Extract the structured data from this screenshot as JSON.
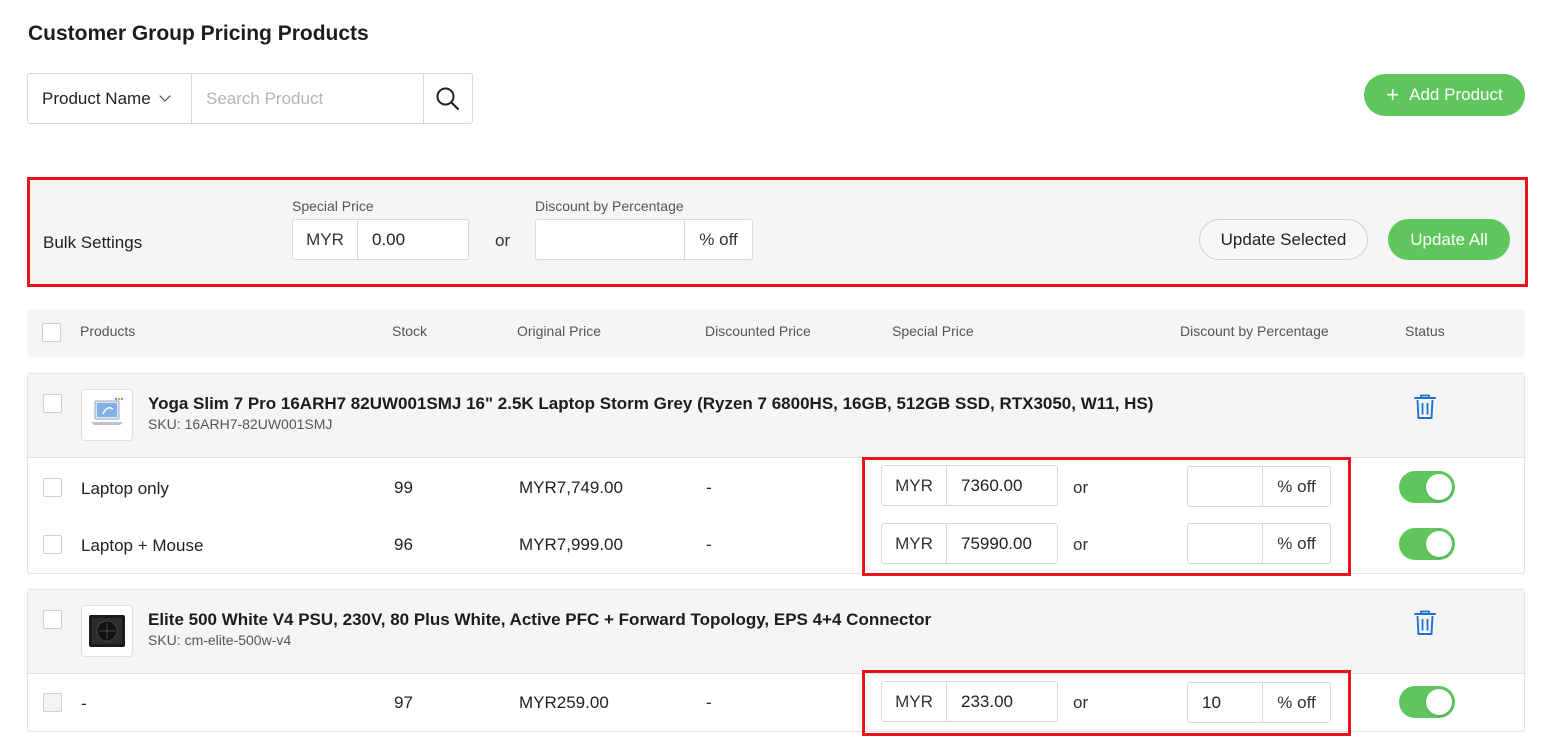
{
  "page_title": "Customer Group Pricing Products",
  "search": {
    "filter_label": "Product Name",
    "placeholder": "Search Product"
  },
  "add_product_label": "Add Product",
  "bulk": {
    "label": "Bulk Settings",
    "special_price_label": "Special Price",
    "currency": "MYR",
    "special_price_value": "0.00",
    "or": "or",
    "discount_label": "Discount by Percentage",
    "discount_value": "",
    "suffix": "% off",
    "update_selected": "Update Selected",
    "update_all": "Update All"
  },
  "table_headers": {
    "products": "Products",
    "stock": "Stock",
    "original_price": "Original Price",
    "discounted_price": "Discounted Price",
    "special_price": "Special Price",
    "discount_pct": "Discount by Percentage",
    "status": "Status"
  },
  "products": [
    {
      "name": "Yoga Slim 7 Pro 16ARH7 82UW001SMJ 16\" 2.5K Laptop Storm Grey (Ryzen 7 6800HS, 16GB, 512GB SSD, RTX3050, W11, HS)",
      "sku": "SKU: 16ARH7-82UW001SMJ",
      "variants": [
        {
          "name": "Laptop only",
          "stock": "99",
          "original_price": "MYR7,749.00",
          "discounted_price": "-",
          "currency": "MYR",
          "special_price": "7360.00",
          "or": "or",
          "discount": "",
          "suffix": "% off",
          "status_on": true
        },
        {
          "name": "Laptop + Mouse",
          "stock": "96",
          "original_price": "MYR7,999.00",
          "discounted_price": "-",
          "currency": "MYR",
          "special_price": "75990.00",
          "or": "or",
          "discount": "",
          "suffix": "% off",
          "status_on": true
        }
      ]
    },
    {
      "name": "Elite 500 White V4 PSU, 230V, 80 Plus White, Active PFC + Forward Topology, EPS 4+4 Connector",
      "sku": "SKU: cm-elite-500w-v4",
      "variants": [
        {
          "name": "-",
          "stock": "97",
          "original_price": "MYR259.00",
          "discounted_price": "-",
          "currency": "MYR",
          "special_price": "233.00",
          "or": "or",
          "discount": "10",
          "suffix": "% off",
          "status_on": true
        }
      ]
    }
  ],
  "colors": {
    "accent_green": "#5ec65c",
    "highlight_red": "#e8141c",
    "icon_blue": "#1f6fd1"
  }
}
